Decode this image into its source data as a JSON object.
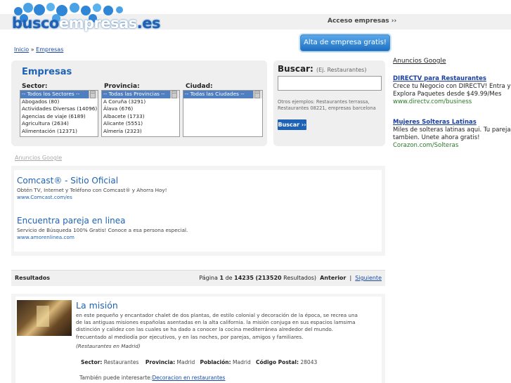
{
  "header": {
    "logo_text_a": "busco",
    "logo_text_b": "empresas",
    "logo_text_c": ".es",
    "acceso": "Acceso empresas ››",
    "alta_button": "Alta de empresa gratis!"
  },
  "breadcrumb": {
    "home": "Inicio",
    "sep": "»",
    "current": "Empresas"
  },
  "search": {
    "title": "Empresas",
    "sector_label": "Sector:",
    "provincia_label": "Provincia:",
    "ciudad_label": "Ciudad:",
    "sector_options": [
      "-- Todos los Sectores --",
      "Abogados (80)",
      "Actividades Diversas (14096)",
      "Agencias de viaje (6189)",
      "Agricultura (2634)",
      "Alimentación (12371)"
    ],
    "provincia_options": [
      "-- Todas las Provincias --",
      "A Coruña (3291)",
      "Álava (676)",
      "Albacete (1733)",
      "Alicante (5551)",
      "Almería (2323)"
    ],
    "ciudad_options": [
      "-- Todas las Ciudades --"
    ],
    "buscar_label": "Buscar:",
    "buscar_hint": "(Ej. Restaurantes)",
    "otros": "Otros ejemplos: Restaurantes terrassa, Restaurantes 08221, empresas barcelona",
    "buscar_button": "Buscar ››"
  },
  "ads_label": "Anuncios Google",
  "ads": [
    {
      "title": "Comcast® - Sitio Oficial",
      "desc": "Obtén TV, Internet y Teléfono con Comcast® y Ahorra Hoy!",
      "url": "www.Comcast.com/es"
    },
    {
      "title": "Encuentra pareja en linea",
      "desc": "Servicio de Búsqueda 100% Gratis! Conoce a esa persona especial.",
      "url": "www.amorenlinea.com"
    }
  ],
  "side_ads": {
    "label": "Anuncios Google",
    "items": [
      {
        "title": "DIRECTV para Restaurantes",
        "desc": "Crece tu Negocio con DIRECTV! Entra y Explora Paquetes desde $49.99/Mes",
        "url": "www.directv.com/business"
      },
      {
        "title": "Mujeres Solteras Latinas",
        "desc": "Miles de solteras latinas aqui. Tu pareja tambien. Unete ahora gratis!",
        "url": "Corazon.com/Solteras"
      }
    ]
  },
  "results": {
    "label": "Resultados",
    "pagina": "Página",
    "page": "1",
    "de": "de",
    "total_pages": "14235",
    "count": "(213520",
    "count_suffix": "Resultados)",
    "anterior": "Anterior",
    "sep": "|",
    "siguiente": "Siguiente"
  },
  "result_item": {
    "title": "La misión",
    "desc": "en este pequeño y encantador chalet de dos plantas, de estilo colonial y decoración de la época, se recrea una de las antiguas misiones españolas asentadas en la alta california. la misión conjuga en sus espacios lamsima distinción y calidez con las cuales se ha dado a conocer la cocina mediterránea alrededor del mundo. frecuentado al mediodía por ejecutivos, y en las noches, por parejas, amigos y familiares.",
    "category": "(Restaurantes en Madrid)",
    "sector_label": "Sector:",
    "sector": "Restaurantes",
    "provincia_label": "Provincia:",
    "provincia": "Madrid",
    "poblacion_label": "Población:",
    "poblacion": "Madrid",
    "cp_label": "Código Postal:",
    "cp": "28043",
    "tambien": "También puede interesarte:",
    "tambien_link": "Decoracion en restaurantes"
  },
  "colors": {
    "brand": "#1e62b5",
    "button": "#1d70c2",
    "selected": "#4f7ec1"
  }
}
